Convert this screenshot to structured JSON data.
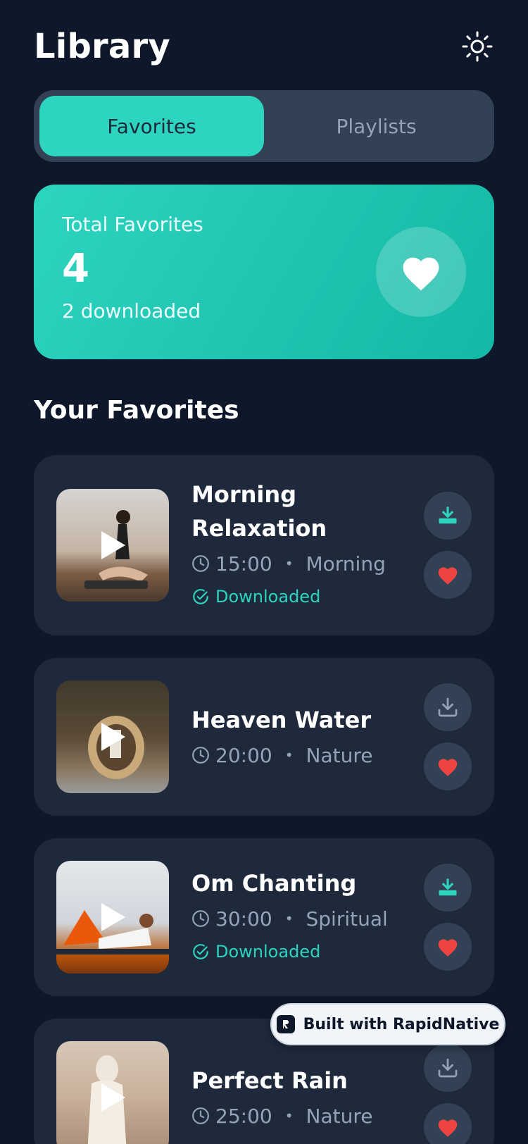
{
  "header": {
    "title": "Library",
    "theme_icon": "sun-icon"
  },
  "tabs": [
    {
      "label": "Favorites",
      "active": true
    },
    {
      "label": "Playlists",
      "active": false
    }
  ],
  "stats": {
    "label": "Total Favorites",
    "count": "4",
    "sub": "2 downloaded",
    "icon": "heart-icon"
  },
  "section_title": "Your Favorites",
  "tracks": [
    {
      "title": "Morning Relaxation",
      "duration": "15:00",
      "category": "Morning",
      "downloaded": true,
      "downloaded_label": "Downloaded",
      "favorite": true
    },
    {
      "title": "Heaven Water",
      "duration": "20:00",
      "category": "Nature",
      "downloaded": false,
      "favorite": true
    },
    {
      "title": "Om Chanting",
      "duration": "30:00",
      "category": "Spiritual",
      "downloaded": true,
      "downloaded_label": "Downloaded",
      "favorite": true
    },
    {
      "title": "Perfect Rain",
      "duration": "25:00",
      "category": "Nature",
      "downloaded": false,
      "favorite": true
    }
  ],
  "badge": {
    "label": "Built with RapidNative"
  },
  "colors": {
    "accent": "#2dd4bf",
    "background": "#0f172a",
    "card": "#1e293b",
    "heart": "#ef4444",
    "muted": "#94a3b8"
  }
}
